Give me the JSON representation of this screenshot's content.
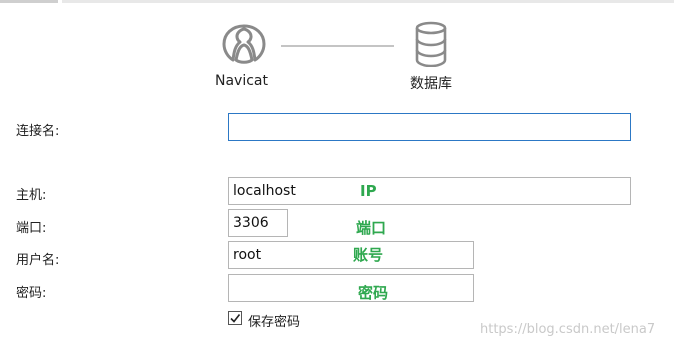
{
  "diagram": {
    "left_label": "Navicat",
    "right_label": "数据库",
    "left_icon": "navicat-logo-icon",
    "right_icon": "database-icon"
  },
  "form": {
    "connection_name": {
      "label": "连接名:",
      "value": ""
    },
    "host": {
      "label": "主机:",
      "value": "localhost"
    },
    "port": {
      "label": "端口:",
      "value": "3306"
    },
    "username": {
      "label": "用户名:",
      "value": "root"
    },
    "password": {
      "label": "密码:",
      "value": ""
    },
    "save_password": {
      "label": "保存密码",
      "checked": true
    }
  },
  "annotations": {
    "host": "IP",
    "port": "端口",
    "username": "账号",
    "password": "密码",
    "color": "#2fa84f"
  },
  "watermark": "https://blog.csdn.net/lena7"
}
